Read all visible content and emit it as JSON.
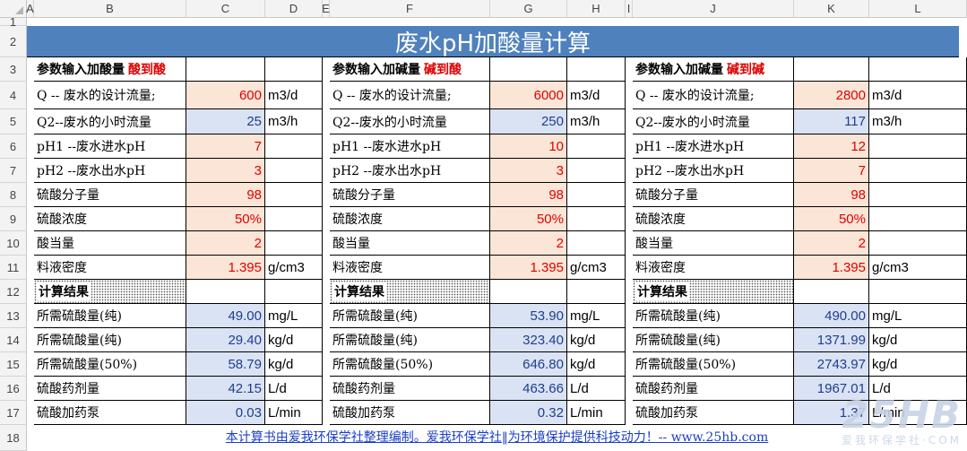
{
  "columns": [
    "A",
    "B",
    "C",
    "D",
    "E",
    "F",
    "G",
    "H",
    "I",
    "J",
    "K",
    "L"
  ],
  "rows": [
    "1",
    "2",
    "3",
    "4",
    "5",
    "6",
    "7",
    "8",
    "9",
    "10",
    "11",
    "12",
    "13",
    "14",
    "15",
    "16",
    "17",
    "18"
  ],
  "title": "废水pH加酸量计算",
  "blocks": [
    {
      "header_label": "参数输入加酸量",
      "header_tag": "酸到酸",
      "inputs": [
        {
          "label": "Q  -- 废水的设计流量;",
          "value": "600",
          "unit": "m3/d",
          "style": "red"
        },
        {
          "label": "Q2--废水的小时流量",
          "value": "25",
          "unit": "m3/h",
          "style": "blue"
        },
        {
          "label": "pH1 --废水进水pH",
          "value": "7",
          "unit": "",
          "style": "red"
        },
        {
          "label": "pH2 --废水出水pH",
          "value": "3",
          "unit": "",
          "style": "red"
        },
        {
          "label": "硫酸分子量",
          "value": "98",
          "unit": "",
          "style": "red"
        },
        {
          "label": "硫酸浓度",
          "value": "50%",
          "unit": "",
          "style": "red"
        },
        {
          "label": "酸当量",
          "value": "2",
          "unit": "",
          "style": "red"
        },
        {
          "label": "料液密度",
          "value": "1.395",
          "unit": "g/cm3",
          "style": "red"
        }
      ],
      "results_label": "计算结果",
      "results": [
        {
          "label": "所需硫酸量(纯)",
          "value": "49.00",
          "unit": "mg/L"
        },
        {
          "label": "所需硫酸量(纯)",
          "value": "29.40",
          "unit": "kg/d"
        },
        {
          "label": "所需硫酸量(50%)",
          "value": "58.79",
          "unit": "kg/d"
        },
        {
          "label": "硫酸药剂量",
          "value": "42.15",
          "unit": "L/d"
        },
        {
          "label": "硫酸加药泵",
          "value": "0.03",
          "unit": "L/min"
        }
      ]
    },
    {
      "header_label": "参数输入加碱量",
      "header_tag": "碱到酸",
      "inputs": [
        {
          "label": "Q  -- 废水的设计流量;",
          "value": "6000",
          "unit": "m3/d",
          "style": "red"
        },
        {
          "label": "Q2--废水的小时流量",
          "value": "250",
          "unit": "m3/h",
          "style": "blue"
        },
        {
          "label": "pH1 --废水进水pH",
          "value": "10",
          "unit": "",
          "style": "red"
        },
        {
          "label": "pH2 --废水出水pH",
          "value": "3",
          "unit": "",
          "style": "red"
        },
        {
          "label": "硫酸分子量",
          "value": "98",
          "unit": "",
          "style": "red"
        },
        {
          "label": "硫酸浓度",
          "value": "50%",
          "unit": "",
          "style": "red"
        },
        {
          "label": "酸当量",
          "value": "2",
          "unit": "",
          "style": "red"
        },
        {
          "label": "料液密度",
          "value": "1.395",
          "unit": "g/cm3",
          "style": "red"
        }
      ],
      "results_label": "计算结果",
      "results": [
        {
          "label": "所需硫酸量(纯)",
          "value": "53.90",
          "unit": "mg/L"
        },
        {
          "label": "所需硫酸量(纯)",
          "value": "323.40",
          "unit": "kg/d"
        },
        {
          "label": "所需硫酸量(50%)",
          "value": "646.80",
          "unit": "kg/d"
        },
        {
          "label": "硫酸药剂量",
          "value": "463.66",
          "unit": "L/d"
        },
        {
          "label": "硫酸加药泵",
          "value": "0.32",
          "unit": "L/min"
        }
      ]
    },
    {
      "header_label": "参数输入加碱量",
      "header_tag": "碱到碱",
      "inputs": [
        {
          "label": "Q  -- 废水的设计流量;",
          "value": "2800",
          "unit": "m3/d",
          "style": "red"
        },
        {
          "label": "Q2--废水的小时流量",
          "value": "117",
          "unit": "m3/h",
          "style": "blue"
        },
        {
          "label": "pH1 --废水进水pH",
          "value": "12",
          "unit": "",
          "style": "red"
        },
        {
          "label": "pH2 --废水出水pH",
          "value": "7",
          "unit": "",
          "style": "red"
        },
        {
          "label": "硫酸分子量",
          "value": "98",
          "unit": "",
          "style": "red"
        },
        {
          "label": "硫酸浓度",
          "value": "50%",
          "unit": "",
          "style": "red"
        },
        {
          "label": "酸当量",
          "value": "2",
          "unit": "",
          "style": "red"
        },
        {
          "label": "料液密度",
          "value": "1.395",
          "unit": "g/cm3",
          "style": "red"
        }
      ],
      "results_label": "计算结果",
      "results": [
        {
          "label": "所需硫酸量(纯)",
          "value": "490.00",
          "unit": "mg/L"
        },
        {
          "label": "所需硫酸量(纯)",
          "value": "1371.99",
          "unit": "kg/d"
        },
        {
          "label": "所需硫酸量(50%)",
          "value": "2743.97",
          "unit": "kg/d"
        },
        {
          "label": "硫酸药剂量",
          "value": "1967.01",
          "unit": "L/d"
        },
        {
          "label": "硫酸加药泵",
          "value": "1.37",
          "unit": "L/min"
        }
      ]
    }
  ],
  "footer": "本计算书由爱我环保学社整理编制。爱我环保学社‖为环境保护提供科技动力！-- www.25hb.com",
  "watermark_big": "25HB",
  "watermark_small": "爱我环保学社·COM",
  "colors": {
    "title_bg": "#4f81bd",
    "peach": "#fbe5d6",
    "light_blue": "#dae3f3",
    "red": "#e00000",
    "link": "#1a3ec8"
  }
}
